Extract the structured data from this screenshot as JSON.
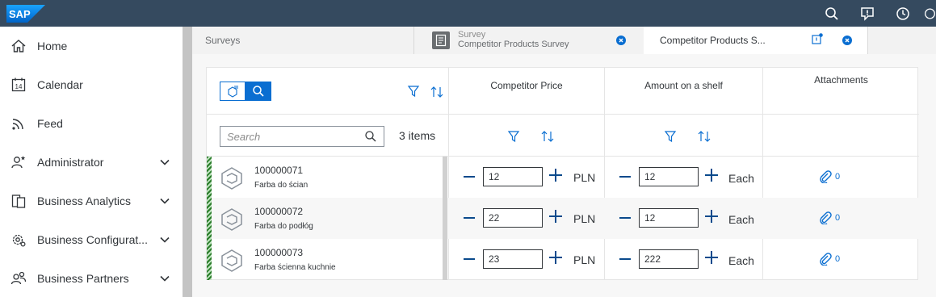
{
  "colors": {
    "shell": "#354a5f",
    "accent": "#0a6ed1",
    "status_hatch": "#2b7c2b"
  },
  "shell": {
    "logo": "SAP"
  },
  "sidebar": {
    "items": [
      {
        "label": "Home",
        "icon": "home-icon",
        "has_chevron": false
      },
      {
        "label": "Calendar",
        "icon": "calendar-icon",
        "icon_text": "14",
        "has_chevron": false
      },
      {
        "label": "Feed",
        "icon": "feed-icon",
        "has_chevron": false
      },
      {
        "label": "Administrator",
        "icon": "administrator-icon",
        "has_chevron": true
      },
      {
        "label": "Business Analytics",
        "icon": "analytics-icon",
        "has_chevron": true
      },
      {
        "label": "Business Configurat...",
        "icon": "configuration-icon",
        "has_chevron": true
      },
      {
        "label": "Business Partners",
        "icon": "partners-icon",
        "has_chevron": true
      }
    ]
  },
  "tabs": [
    {
      "label": "Surveys"
    },
    {
      "title": "Survey",
      "subtitle": "Competitor Products Survey",
      "icon": "survey-icon"
    },
    {
      "title": "Competitor Products S...",
      "icon": "notification-badge-icon"
    }
  ],
  "table": {
    "columns": [
      "Competitor Price",
      "Amount on a shelf",
      "Attachments"
    ],
    "search_placeholder": "Search",
    "items_count": "3 items",
    "rows": [
      {
        "id": "100000071",
        "name": "Farba do ścian",
        "price": "12",
        "price_unit": "PLN",
        "amount": "12",
        "amount_unit": "Each",
        "attachments": "0"
      },
      {
        "id": "100000072",
        "name": "Farba do podłóg",
        "price": "22",
        "price_unit": "PLN",
        "amount": "12",
        "amount_unit": "Each",
        "attachments": "0"
      },
      {
        "id": "100000073",
        "name": "Farba ścienna kuchnie",
        "price": "23",
        "price_unit": "PLN",
        "amount": "222",
        "amount_unit": "Each",
        "attachments": "0"
      }
    ]
  }
}
